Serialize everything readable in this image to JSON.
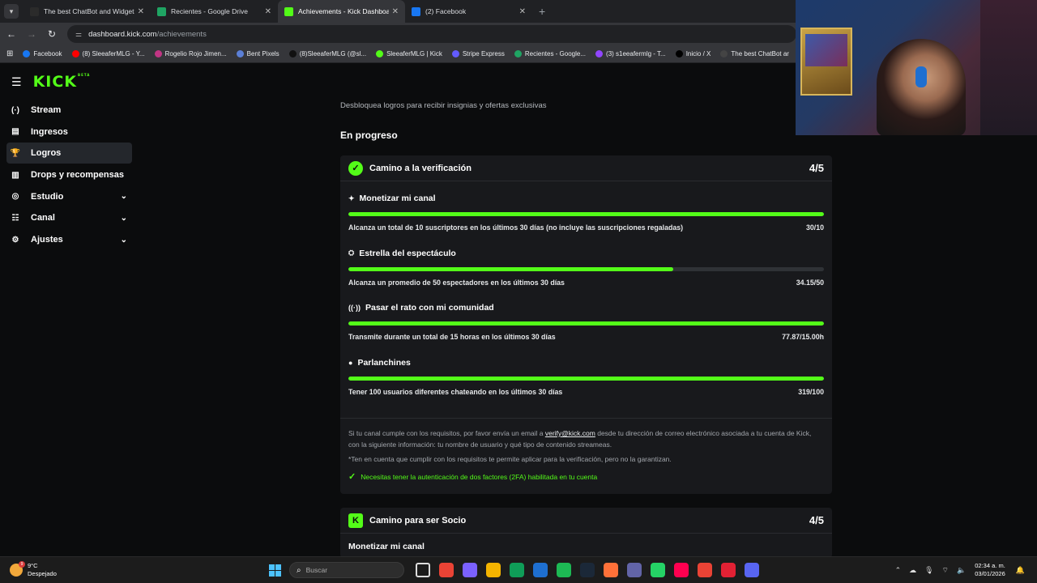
{
  "browser": {
    "tabs": [
      {
        "label": "The best ChatBot and Widgets",
        "color": "#2b2b2b"
      },
      {
        "label": "Recientes - Google Drive",
        "color": "#1fa463"
      },
      {
        "label": "Achievements - Kick Dashboard",
        "color": "#53fc18",
        "active": true
      },
      {
        "label": "(2) Facebook",
        "color": "#1877f2"
      }
    ],
    "url_host": "dashboard.kick.com",
    "url_path": "/achievements",
    "bookmarks": [
      {
        "label": "Facebook",
        "color": "#1877f2"
      },
      {
        "label": "(8) SleeaferMLG - Y...",
        "color": "#ff0000"
      },
      {
        "label": "Rogelio Rojo Jimen...",
        "color": "#c13584"
      },
      {
        "label": "Bent Pixels",
        "color": "#5b7fd6"
      },
      {
        "label": "(8)SleeaferMLG (@sl...",
        "color": "#111111"
      },
      {
        "label": "SleeaferMLG | Kick",
        "color": "#53fc18"
      },
      {
        "label": "Stripe Express",
        "color": "#635bff"
      },
      {
        "label": "Recientes - Google...",
        "color": "#1fa463"
      },
      {
        "label": "(3) s1eeafermlg - T...",
        "color": "#9146ff"
      },
      {
        "label": "Inicio / X",
        "color": "#000000"
      },
      {
        "label": "The best ChatBot ar",
        "color": "#444444"
      }
    ]
  },
  "sidebar": {
    "logo": "KICK",
    "logo_badge": "BETA",
    "items": [
      {
        "label": "Stream",
        "icon": "(·)",
        "name": "stream",
        "chevron": false
      },
      {
        "label": "Ingresos",
        "icon": "▤",
        "name": "ingresos",
        "chevron": false
      },
      {
        "label": "Logros",
        "icon": "🏆",
        "name": "logros",
        "chevron": false,
        "active": true
      },
      {
        "label": "Drops y recompensas",
        "icon": "▥",
        "name": "drops",
        "chevron": false
      },
      {
        "label": "Estudio",
        "icon": "◎",
        "name": "estudio",
        "chevron": true
      },
      {
        "label": "Canal",
        "icon": "☷",
        "name": "canal",
        "chevron": true
      },
      {
        "label": "Ajustes",
        "icon": "⚙",
        "name": "ajustes",
        "chevron": true
      }
    ]
  },
  "main": {
    "subtitle": "Desbloquea logros para recibir insignias y ofertas exclusivas",
    "section_title": "En progreso",
    "card1": {
      "title": "Camino a la verificación",
      "count": "4/5",
      "tasks": [
        {
          "title": "Monetizar mi canal",
          "icon": "✦",
          "desc": "Alcanza un total de 10 suscriptores en los últimos 30 días (no incluye las suscripciones regaladas)",
          "value": "30/10",
          "progress": 1.0
        },
        {
          "title": "Estrella del espectáculo",
          "icon": "⛭",
          "desc": "Alcanza un promedio de 50 espectadores en los últimos 30 días",
          "value": "34.15/50",
          "progress": 0.683
        },
        {
          "title": "Pasar el rato con mi comunidad",
          "icon": "((·))",
          "desc": "Transmite durante un total de 15 horas en los últimos 30 días",
          "value": "77.87/15.00h",
          "progress": 1.0
        },
        {
          "title": "Parlanchines",
          "icon": "●",
          "desc": "Tener 100 usuarios diferentes chateando en los últimos 30 días",
          "value": "319/100",
          "progress": 1.0
        }
      ],
      "info_pre": "Si tu canal cumple con los requisitos, por favor envía un email a ",
      "info_email": "verify@kick.com",
      "info_post": " desde tu dirección de correo electrónico asociada a tu cuenta de Kick, con la siguiente información: tu nombre de usuario y qué tipo de contenido streameas.",
      "note": "*Ten en cuenta que cumplir con los requisitos te permite aplicar para la verificación, pero no la garantizan.",
      "requirement": "Necesitas tener la autenticación de dos factores (2FA) habilitada en tu cuenta"
    },
    "card2": {
      "title": "Camino para ser Socio",
      "count": "4/5",
      "peek": "Monetizar mi canal"
    }
  },
  "taskbar": {
    "temp": "9°C",
    "weather": "Despejado",
    "search_placeholder": "Buscar",
    "time": "02:34 a. m.",
    "date": "03/01/2026",
    "badge": "9",
    "app_colors": [
      "#ffffff",
      "#ea4335",
      "#7b61ff",
      "#f4b400",
      "#0f9d58",
      "#1e6fd0",
      "#1db954",
      "#1b2838",
      "#ff7139",
      "#6264a7",
      "#25d366",
      "#ff0050",
      "#ea4335",
      "#e22134",
      "#5865f2"
    ]
  }
}
